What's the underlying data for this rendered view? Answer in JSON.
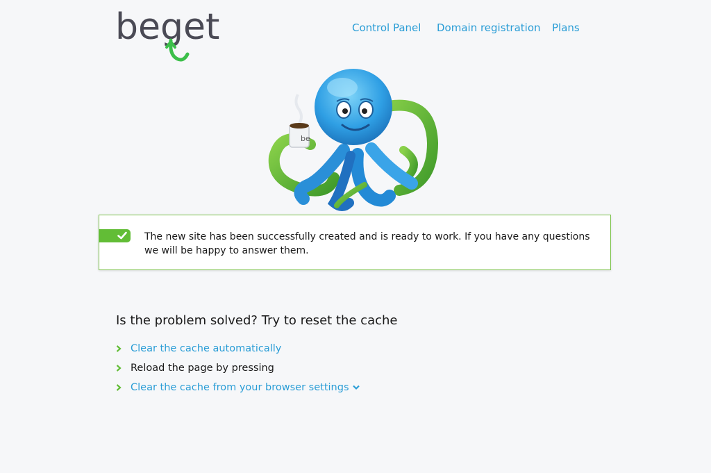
{
  "brand": {
    "name": "beget"
  },
  "nav": {
    "control_panel": "Control Panel",
    "domain_registration": "Domain registration",
    "plans": "Plans"
  },
  "mascot": {
    "mug_text": "be"
  },
  "notice": {
    "message": "The new site has been successfully created and is ready to work. If you have any questions we will be happy to answer them."
  },
  "cache": {
    "heading": "Is the problem solved? Try to reset the cache",
    "items": [
      {
        "label": "Clear the cache automatically",
        "link": true
      },
      {
        "label": "Reload the page by pressing",
        "link": false
      },
      {
        "label": "Clear the cache from your browser settings",
        "link": true,
        "expandable": true
      }
    ]
  },
  "colors": {
    "background": "#f6f7f9",
    "link": "#2a9dd6",
    "accent_green": "#62bd36",
    "border_green": "#7cc24a",
    "logo_gray": "#4a4a55"
  },
  "icons": [
    "logo",
    "octopus-mascot",
    "check-icon",
    "chevron-right-icon",
    "chevron-down-icon"
  ]
}
